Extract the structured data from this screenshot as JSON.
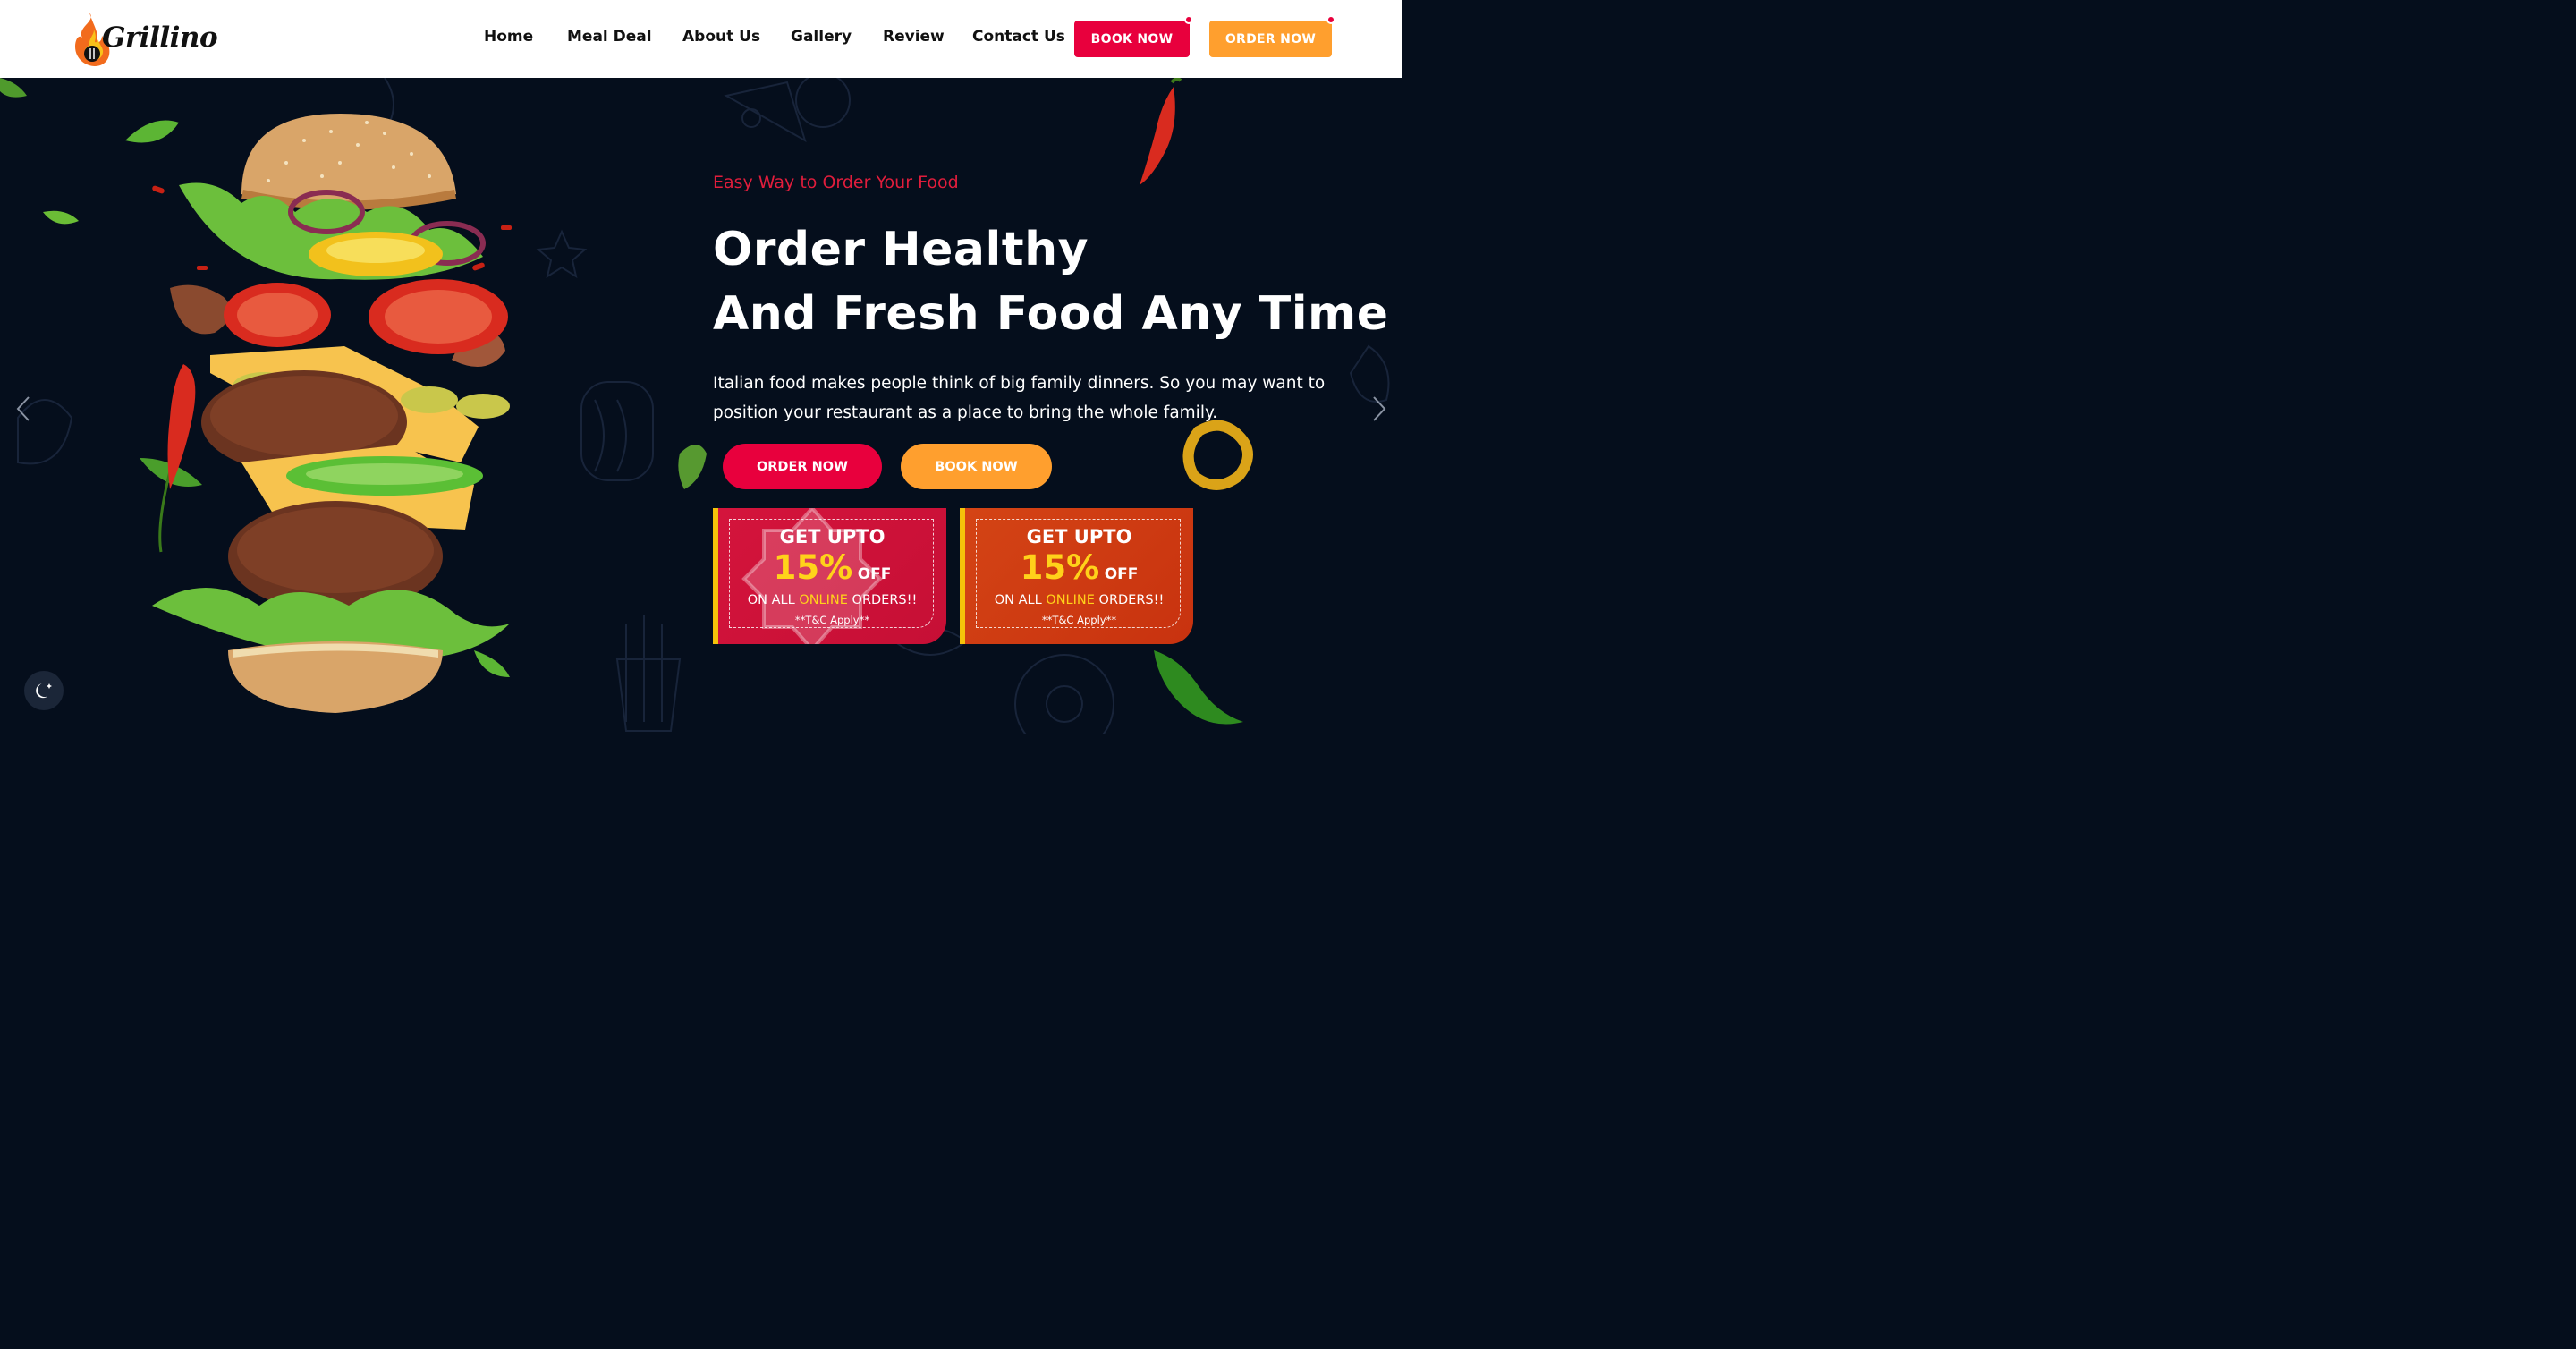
{
  "brand": {
    "logo_text": "Grillino"
  },
  "nav": {
    "items": [
      {
        "label": "Home"
      },
      {
        "label": "Meal Deal"
      },
      {
        "label": "About Us"
      },
      {
        "label": "Gallery"
      },
      {
        "label": "Review"
      },
      {
        "label": "Contact Us"
      }
    ],
    "book_now": "BOOK NOW",
    "order_now": "ORDER NOW"
  },
  "hero": {
    "tagline": "Easy Way to Order Your Food",
    "headline_line1": "Order Healthy",
    "headline_line2": "And Fresh Food Any Time",
    "description": "Italian food makes people think of big family dinners. So you may want to position your restaurant as a place to bring the whole family.",
    "order_button": "ORDER NOW",
    "book_button": "BOOK NOW"
  },
  "coupons": [
    {
      "line1": "GET UPTO",
      "percent": "15%",
      "off": "OFF",
      "line3_pre": "ON ALL ",
      "line3_hl": "ONLINE",
      "line3_post": " ORDERS!!",
      "terms": "**T&C Apply**"
    },
    {
      "line1": "GET UPTO",
      "percent": "15%",
      "off": "OFF",
      "line3_pre": "ON ALL ",
      "line3_hl": "ONLINE",
      "line3_post": " ORDERS!!",
      "terms": "**T&C Apply**"
    }
  ],
  "icons": {
    "prev": "chevron-left-icon",
    "next": "chevron-right-icon",
    "theme_toggle": "moon-icon"
  },
  "colors": {
    "accent_red": "#e8003d",
    "accent_orange": "#ff9f2e",
    "hero_bg": "#050e1c",
    "tagline": "#e11d3c",
    "coupon_yellow": "#ffd21a"
  }
}
